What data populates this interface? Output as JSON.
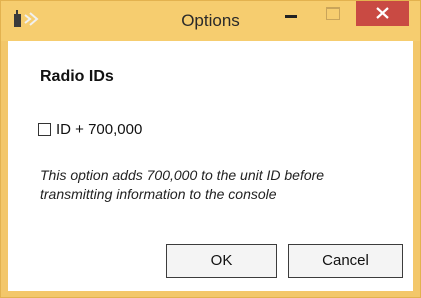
{
  "window": {
    "title": "Options",
    "icons": {
      "app": "radio-app-icon",
      "minimize": "minimize-icon",
      "maximize": "maximize-icon",
      "close": "close-icon"
    },
    "colors": {
      "frame": "#f3c76a",
      "close_button": "#c94a43"
    }
  },
  "dialog": {
    "section_title": "Radio IDs",
    "checkbox": {
      "label": "ID + 700,000",
      "checked": false
    },
    "description": "This option adds 700,000 to the unit ID before transmitting information to the console",
    "buttons": {
      "ok": "OK",
      "cancel": "Cancel"
    }
  }
}
